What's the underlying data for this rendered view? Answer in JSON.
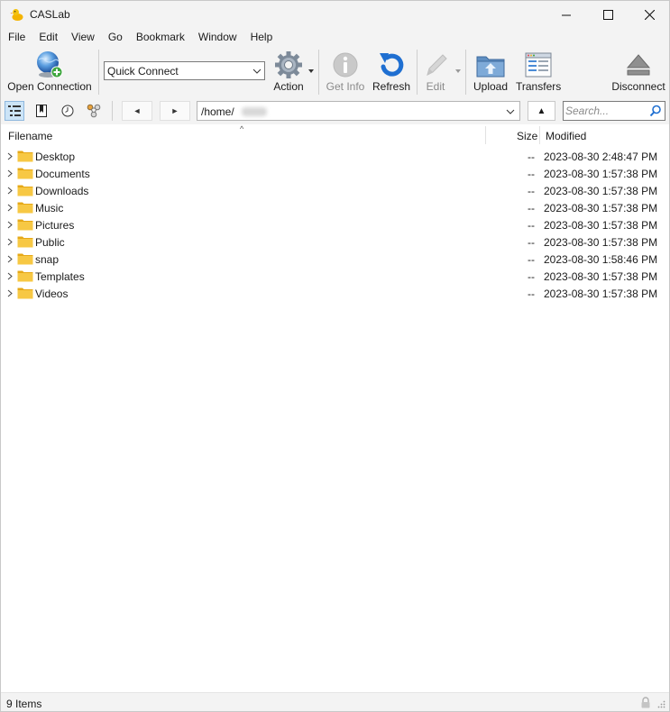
{
  "window": {
    "title": "CASLab"
  },
  "menu": [
    "File",
    "Edit",
    "View",
    "Go",
    "Bookmark",
    "Window",
    "Help"
  ],
  "toolbar": {
    "open_connection": "Open Connection",
    "quick_connect": "Quick Connect",
    "action": "Action",
    "get_info": "Get Info",
    "refresh": "Refresh",
    "edit": "Edit",
    "upload": "Upload",
    "transfers": "Transfers",
    "disconnect": "Disconnect"
  },
  "nav": {
    "back_glyph": "◄",
    "forward_glyph": "►",
    "up_glyph": "▲",
    "path": "/home/",
    "search_placeholder": "Search..."
  },
  "columns": {
    "filename": "Filename",
    "size": "Size",
    "modified": "Modified",
    "sort_glyph": "^"
  },
  "files": [
    {
      "name": "Desktop",
      "size": "--",
      "modified": "2023-08-30 2:48:47 PM"
    },
    {
      "name": "Documents",
      "size": "--",
      "modified": "2023-08-30 1:57:38 PM"
    },
    {
      "name": "Downloads",
      "size": "--",
      "modified": "2023-08-30 1:57:38 PM"
    },
    {
      "name": "Music",
      "size": "--",
      "modified": "2023-08-30 1:57:38 PM"
    },
    {
      "name": "Pictures",
      "size": "--",
      "modified": "2023-08-30 1:57:38 PM"
    },
    {
      "name": "Public",
      "size": "--",
      "modified": "2023-08-30 1:57:38 PM"
    },
    {
      "name": "snap",
      "size": "--",
      "modified": "2023-08-30 1:58:46 PM"
    },
    {
      "name": "Templates",
      "size": "--",
      "modified": "2023-08-30 1:57:38 PM"
    },
    {
      "name": "Videos",
      "size": "--",
      "modified": "2023-08-30 1:57:38 PM"
    }
  ],
  "status": {
    "items": "9 Items"
  },
  "icons": {
    "app": "rubber-duck-icon",
    "open_connection": "globe-plus-icon",
    "action": "gear-icon",
    "get_info": "info-icon",
    "refresh": "refresh-icon",
    "edit": "pencil-icon",
    "upload": "folder-upload-icon",
    "transfers": "transfers-window-icon",
    "disconnect": "eject-icon",
    "folder": "folder-icon"
  },
  "colors": {
    "chrome": "#f3f3f3",
    "folder": "#f7c844",
    "accent": "#0a66c2",
    "selected_view": "#cce4f7"
  }
}
